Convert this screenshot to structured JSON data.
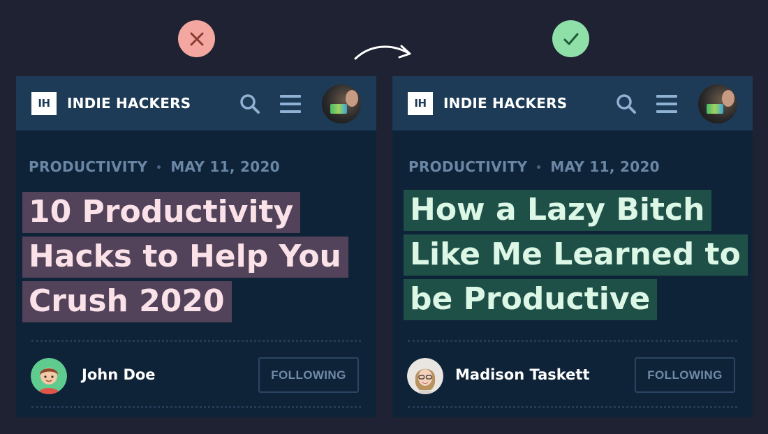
{
  "comparison": {
    "bad_icon": "x-icon",
    "good_icon": "check-icon",
    "bad_color": "#f3a7a0",
    "good_color": "#8fdfa9",
    "arrow_icon": "curved-arrow-right-icon"
  },
  "cards": [
    {
      "header": {
        "logo": "IH",
        "brand": "INDIE HACKERS"
      },
      "category": "PRODUCTIVITY",
      "date": "MAY 11, 2020",
      "title_lines": [
        "10 Productivity",
        "Hacks to Help You",
        "Crush 2020"
      ],
      "author": "John Doe",
      "follow_label": "FOLLOWING"
    },
    {
      "header": {
        "logo": "IH",
        "brand": "INDIE HACKERS"
      },
      "category": "PRODUCTIVITY",
      "date": "MAY 11, 2020",
      "title_lines": [
        "How a Lazy Bitch",
        "Like Me Learned to",
        "be Productive"
      ],
      "author": "Madison Taskett",
      "follow_label": "FOLLOWING"
    }
  ]
}
